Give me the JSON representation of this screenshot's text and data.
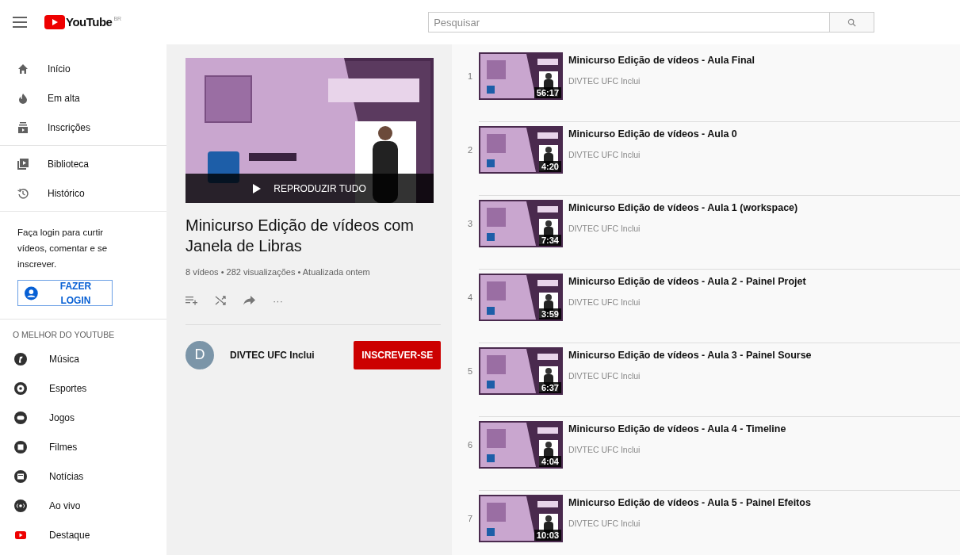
{
  "header": {
    "logo": "YouTube",
    "region": "BR",
    "search": {
      "placeholder": "Pesquisar"
    }
  },
  "sidebar": {
    "sections": [
      {
        "items": [
          {
            "label": "Início",
            "selected": false
          },
          {
            "label": "Em alta",
            "selected": false
          },
          {
            "label": "Inscrições",
            "selected": false
          }
        ]
      },
      {
        "items": [
          {
            "label": "Biblioteca",
            "selected": false
          },
          {
            "label": "Histórico",
            "selected": false
          }
        ]
      }
    ],
    "login_prompt": "Faça login para curtir vídeos, comentar e se inscrever.",
    "login_button": "FAZER LOGIN",
    "best_heading": "O MELHOR DO YOUTUBE",
    "best_items": [
      {
        "label": "Música"
      },
      {
        "label": "Esportes"
      },
      {
        "label": "Jogos"
      },
      {
        "label": "Filmes"
      },
      {
        "label": "Notícias"
      },
      {
        "label": "Ao vivo"
      },
      {
        "label": "Destaque"
      }
    ]
  },
  "playlist": {
    "play_all": "REPRODUZIR TUDO",
    "title": "Minicurso Edição de vídeos com Janela de Libras",
    "stats": "8 vídeos • 282 visualizações • Atualizada ontem",
    "more": "···",
    "channel_initial": "D",
    "channel": "DIVTEC UFC Inclui",
    "subscribe": "INSCREVER-SE"
  },
  "videos": [
    {
      "index": "1",
      "title": "Minicurso Edição de vídeos - Aula Final",
      "channel": "DIVTEC UFC Inclui",
      "duration": "56:17"
    },
    {
      "index": "2",
      "title": "Minicurso Edição de vídeos - Aula 0",
      "channel": "DIVTEC UFC Inclui",
      "duration": "4:20"
    },
    {
      "index": "3",
      "title": "Minicurso Edição de vídeos - Aula 1 (workspace)",
      "channel": "DIVTEC UFC Inclui",
      "duration": "7:34"
    },
    {
      "index": "4",
      "title": "Minicurso Edição de vídeos - Aula 2 - Painel Projet",
      "channel": "DIVTEC UFC Inclui",
      "duration": "3:59"
    },
    {
      "index": "5",
      "title": "Minicurso Edição de vídeos - Aula 3 - Painel Sourse",
      "channel": "DIVTEC UFC Inclui",
      "duration": "6:37"
    },
    {
      "index": "6",
      "title": "Minicurso Edição de vídeos - Aula 4 - Timeline",
      "channel": "DIVTEC UFC Inclui",
      "duration": "4:04"
    },
    {
      "index": "7",
      "title": "Minicurso Edição de vídeos - Aula 5 - Painel Efeitos",
      "channel": "DIVTEC UFC Inclui",
      "duration": "10:03"
    }
  ]
}
